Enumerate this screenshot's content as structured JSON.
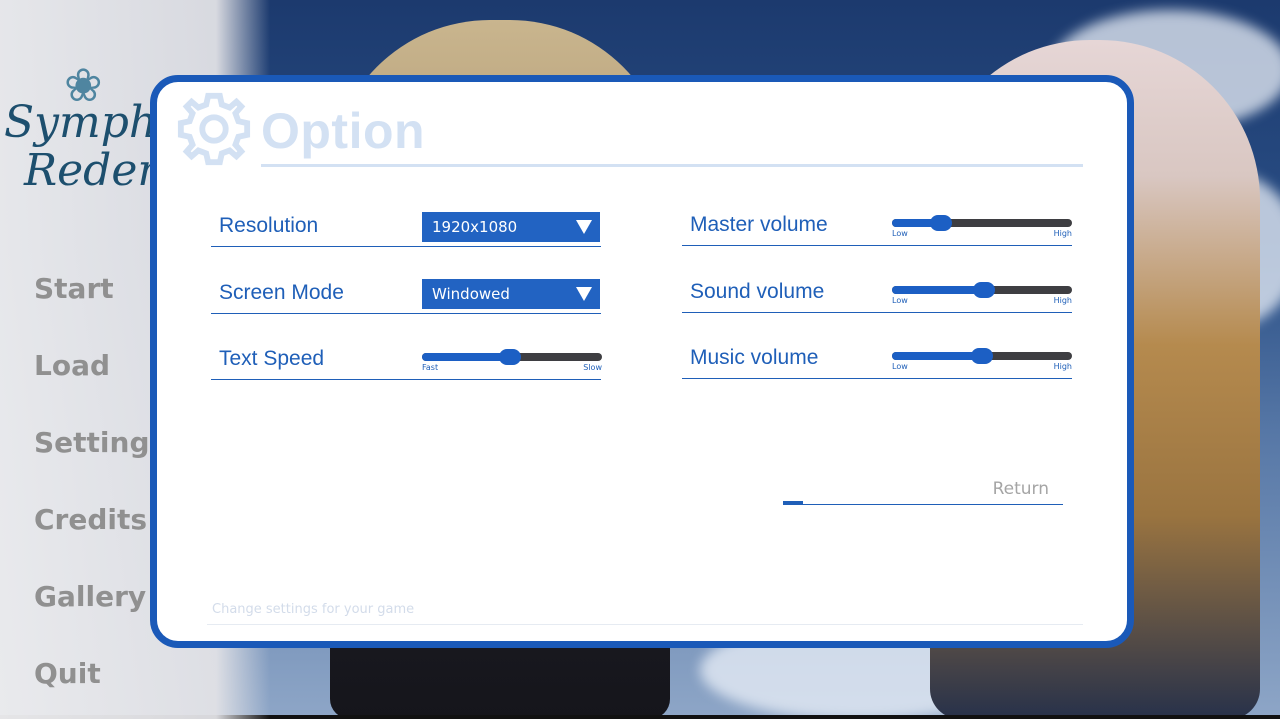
{
  "menu": {
    "logo_line1": "Sympho",
    "logo_line2": "Reden",
    "items": [
      {
        "label": "Start"
      },
      {
        "label": "Load"
      },
      {
        "label": "Settings"
      },
      {
        "label": "Credits"
      },
      {
        "label": "Gallery"
      },
      {
        "label": "Quit"
      }
    ]
  },
  "dialog": {
    "title": "Option",
    "icon": "gear-icon",
    "hint": "Change settings for your game",
    "return_label": "Return",
    "resolution": {
      "label": "Resolution",
      "value": "1920x1080"
    },
    "screen_mode": {
      "label": "Screen Mode",
      "value": "Windowed"
    },
    "text_speed": {
      "label": "Text Speed",
      "low": "Fast",
      "high": "Slow",
      "level": 0.49
    },
    "master_volume": {
      "label": "Master volume",
      "low": "Low",
      "high": "High",
      "level": 0.27
    },
    "sound_volume": {
      "label": "Sound volume",
      "low": "Low",
      "high": "High",
      "level": 0.51
    },
    "music_volume": {
      "label": "Music volume",
      "low": "Low",
      "high": "High",
      "level": 0.5
    }
  },
  "colors": {
    "accent": "#1a59b8",
    "label": "#1f5fb8",
    "title_faded": "#d3e1f3",
    "menu_text": "#909090"
  }
}
